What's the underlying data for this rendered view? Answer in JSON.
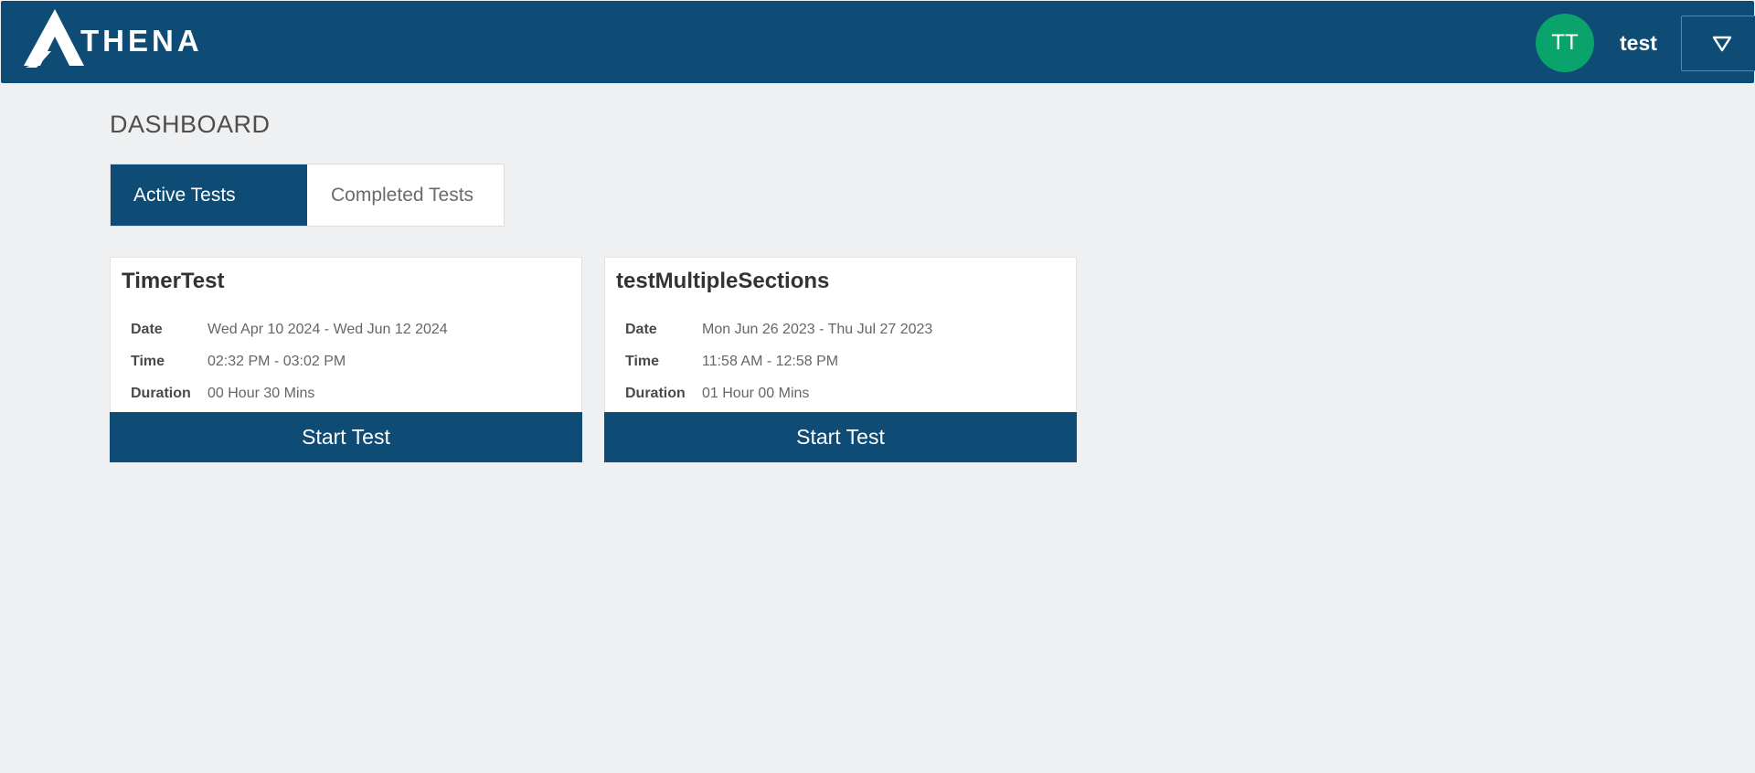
{
  "header": {
    "logo_text": "THENA",
    "avatar_initials": "TT",
    "username": "test",
    "dropdown_icon": "triangle-down-icon"
  },
  "colors": {
    "primary": "#0f4c75",
    "avatar": "#0aa36b",
    "background": "#eff0f2"
  },
  "page": {
    "title": "DASHBOARD"
  },
  "tabs": [
    {
      "label": "Active Tests",
      "active": true
    },
    {
      "label": "Completed Tests",
      "active": false
    }
  ],
  "cards": [
    {
      "title": "TimerTest",
      "date_label": "Date",
      "date_value": "Wed Apr 10 2024 - Wed Jun 12 2024",
      "time_label": "Time",
      "time_value": "02:32 PM - 03:02 PM",
      "duration_label": "Duration",
      "duration_value": "00 Hour 30 Mins",
      "button_label": "Start Test"
    },
    {
      "title": "testMultipleSections",
      "date_label": "Date",
      "date_value": "Mon Jun 26 2023 - Thu Jul 27 2023",
      "time_label": "Time",
      "time_value": "11:58 AM - 12:58 PM",
      "duration_label": "Duration",
      "duration_value": "01 Hour 00 Mins",
      "button_label": "Start Test"
    }
  ]
}
